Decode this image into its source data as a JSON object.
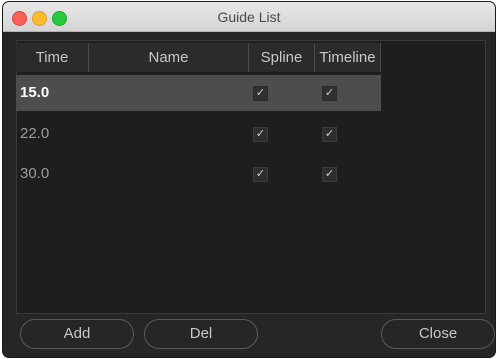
{
  "window": {
    "title": "Guide List"
  },
  "table": {
    "columns": [
      "Time",
      "Name",
      "Spline",
      "Timeline"
    ],
    "rows": [
      {
        "time": "15.0",
        "name": "",
        "spline": true,
        "timeline": true,
        "selected": true
      },
      {
        "time": "22.0",
        "name": "",
        "spline": true,
        "timeline": true,
        "selected": false
      },
      {
        "time": "30.0",
        "name": "",
        "spline": true,
        "timeline": true,
        "selected": false
      }
    ]
  },
  "buttons": {
    "add": "Add",
    "del": "Del",
    "close": "Close"
  },
  "check_glyph": "✓",
  "colors": {
    "window_bg": "#262626",
    "panel_bg": "#1e1e1e",
    "selected_row": "#4d4d4d",
    "traffic_close": "#fc5f57",
    "traffic_min": "#fdbc2e",
    "traffic_max": "#28c840"
  }
}
